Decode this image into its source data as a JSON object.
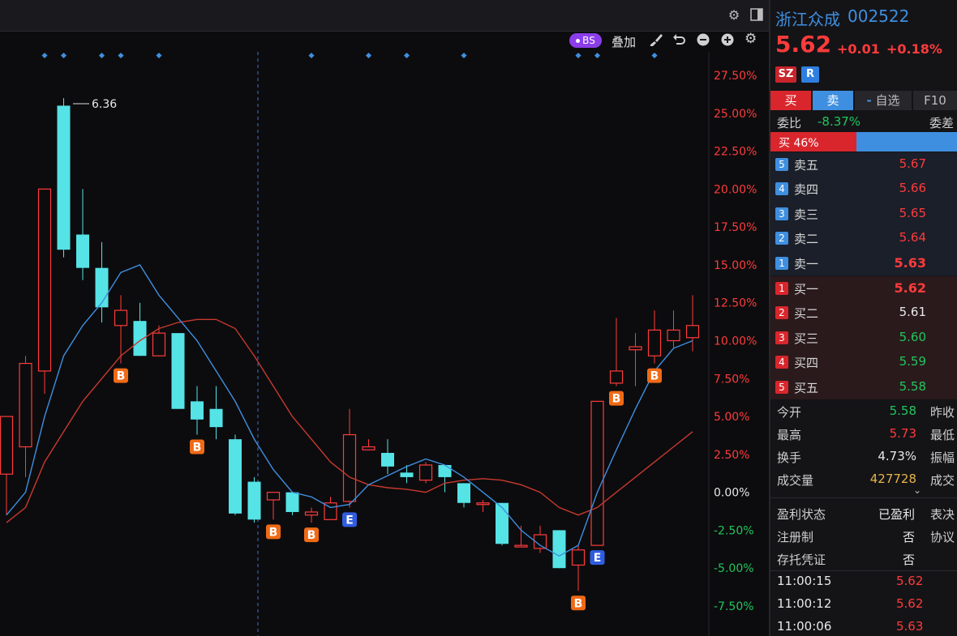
{
  "toolbar": {
    "bs_label": "BS",
    "overlay_label": "叠加"
  },
  "axis": {
    "right_labels": [
      "27.50%",
      "25.00%",
      "22.50%",
      "20.00%",
      "17.50%",
      "15.00%",
      "12.50%",
      "10.00%",
      "7.50%",
      "5.00%",
      "2.50%",
      "0.00%",
      "-2.50%",
      "-5.00%",
      "-7.50%"
    ],
    "top_marker_label": "6.36"
  },
  "colors": {
    "up": "#ff3b3b",
    "down": "#55e3e6",
    "ma_short": "#3f8fe0",
    "ma_long": "#c8392f",
    "b_marker": "#f06a16",
    "e_marker": "#2f5de0"
  },
  "chart_data": {
    "type": "candlestick",
    "y_axis": {
      "min_percent": -7.5,
      "max_percent": 27.5,
      "base_price": 5.62
    },
    "candles": [
      {
        "o": 1.2,
        "h": 5.0,
        "l": -1.5,
        "c": 5.0,
        "dir": "up"
      },
      {
        "o": 3.0,
        "h": 9.0,
        "l": 1.0,
        "c": 8.5,
        "dir": "up"
      },
      {
        "o": 8.0,
        "h": 20.0,
        "l": 6.5,
        "c": 20.0,
        "dir": "up"
      },
      {
        "o": 16.0,
        "h": 26.0,
        "l": 15.5,
        "c": 25.5,
        "dir": "down"
      },
      {
        "o": 17.0,
        "h": 20.0,
        "l": 14.0,
        "c": 14.8,
        "dir": "down"
      },
      {
        "o": 14.8,
        "h": 16.5,
        "l": 11.2,
        "c": 12.2,
        "dir": "down"
      },
      {
        "o": 11.0,
        "h": 13.0,
        "l": 8.5,
        "c": 12.0,
        "dir": "up"
      },
      {
        "o": 11.3,
        "h": 12.5,
        "l": 9.0,
        "c": 9.0,
        "dir": "down"
      },
      {
        "o": 9.0,
        "h": 11.0,
        "l": 9.0,
        "c": 10.5,
        "dir": "up"
      },
      {
        "o": 10.5,
        "h": 10.5,
        "l": 5.5,
        "c": 5.5,
        "dir": "down"
      },
      {
        "o": 6.0,
        "h": 7.0,
        "l": 3.8,
        "c": 4.8,
        "dir": "down"
      },
      {
        "o": 5.5,
        "h": 7.0,
        "l": 3.5,
        "c": 4.3,
        "dir": "down"
      },
      {
        "o": 3.5,
        "h": 3.8,
        "l": -1.5,
        "c": -1.4,
        "dir": "down"
      },
      {
        "o": 0.7,
        "h": 1.0,
        "l": -2.0,
        "c": -1.8,
        "dir": "down"
      },
      {
        "o": -0.5,
        "h": 0.0,
        "l": -1.8,
        "c": 0.0,
        "dir": "up"
      },
      {
        "o": 0.0,
        "h": 0.0,
        "l": -1.5,
        "c": -1.3,
        "dir": "down"
      },
      {
        "o": -1.5,
        "h": -1.0,
        "l": -2.0,
        "c": -1.3,
        "dir": "up"
      },
      {
        "o": -1.8,
        "h": -0.3,
        "l": -1.8,
        "c": -0.7,
        "dir": "up"
      },
      {
        "o": -0.6,
        "h": 5.5,
        "l": -1.0,
        "c": 3.8,
        "dir": "up"
      },
      {
        "o": 2.8,
        "h": 3.5,
        "l": 2.8,
        "c": 3.0,
        "dir": "up"
      },
      {
        "o": 2.6,
        "h": 3.5,
        "l": 1.2,
        "c": 1.7,
        "dir": "down"
      },
      {
        "o": 1.3,
        "h": 1.8,
        "l": 0.6,
        "c": 1.0,
        "dir": "down"
      },
      {
        "o": 0.8,
        "h": 2.0,
        "l": 0.6,
        "c": 1.8,
        "dir": "up"
      },
      {
        "o": 1.8,
        "h": 1.8,
        "l": 0.0,
        "c": 1.0,
        "dir": "down"
      },
      {
        "o": 0.6,
        "h": 0.6,
        "l": -1.0,
        "c": -0.7,
        "dir": "down"
      },
      {
        "o": -0.7,
        "h": -0.5,
        "l": -1.3,
        "c": -0.8,
        "dir": "up"
      },
      {
        "o": -0.7,
        "h": -0.7,
        "l": -3.5,
        "c": -3.4,
        "dir": "down"
      },
      {
        "o": -3.5,
        "h": -2.2,
        "l": -3.6,
        "c": -3.5,
        "dir": "up"
      },
      {
        "o": -3.7,
        "h": -2.2,
        "l": -4.0,
        "c": -2.8,
        "dir": "up"
      },
      {
        "o": -2.5,
        "h": -2.5,
        "l": -5.0,
        "c": -5.0,
        "dir": "down"
      },
      {
        "o": -4.8,
        "h": -3.5,
        "l": -6.5,
        "c": -3.8,
        "dir": "up"
      },
      {
        "o": -3.5,
        "h": 6.0,
        "l": -3.5,
        "c": 6.0,
        "dir": "up"
      },
      {
        "o": 7.2,
        "h": 11.5,
        "l": 7.0,
        "c": 8.0,
        "dir": "up"
      },
      {
        "o": 9.4,
        "h": 10.5,
        "l": 7.0,
        "c": 9.6,
        "dir": "up"
      },
      {
        "o": 9.0,
        "h": 12.0,
        "l": 8.5,
        "c": 10.7,
        "dir": "up"
      },
      {
        "o": 10.0,
        "h": 12.0,
        "l": 9.5,
        "c": 10.7,
        "dir": "up"
      },
      {
        "o": 10.2,
        "h": 13.0,
        "l": 9.3,
        "c": 11.0,
        "dir": "up"
      }
    ],
    "ma_short": [
      -1.5,
      0,
      5,
      9,
      11,
      12.5,
      14.5,
      15,
      13,
      11.5,
      10,
      8,
      6,
      3.5,
      1.5,
      0,
      -0.3,
      -1,
      -0.8,
      0.5,
      1.1,
      1.7,
      2.2,
      1.8,
      1,
      0,
      -1,
      -2.5,
      -3.5,
      -4.2,
      -3.5,
      0,
      2.8,
      5.5,
      8,
      9.5,
      10
    ],
    "ma_long": [
      -2,
      -1,
      2,
      4,
      6,
      7.5,
      9,
      10,
      10.8,
      11.2,
      11.4,
      11.4,
      10.8,
      9,
      7,
      5,
      3.5,
      2,
      1,
      0.5,
      0.3,
      0.2,
      0,
      0.6,
      0.8,
      0.9,
      0.8,
      0.5,
      0,
      -1,
      -1.5,
      -1,
      0,
      1,
      2,
      3,
      4
    ]
  },
  "markers": {
    "b_label": "B",
    "e_label": "E",
    "list": [
      {
        "type": "B",
        "candle": 6
      },
      {
        "type": "B",
        "candle": 10
      },
      {
        "type": "B",
        "candle": 14
      },
      {
        "type": "B",
        "candle": 16
      },
      {
        "type": "E",
        "candle": 18
      },
      {
        "type": "B",
        "candle": 30
      },
      {
        "type": "E",
        "candle": 31
      },
      {
        "type": "B",
        "candle": 32
      },
      {
        "type": "B",
        "candle": 34
      }
    ],
    "top_dots": [
      2,
      3,
      5,
      6,
      8,
      16,
      19,
      21,
      24,
      30,
      31,
      34
    ]
  },
  "panel": {
    "stock_name": "浙江众成",
    "stock_code": "002522",
    "price": "5.62",
    "change": "+0.01",
    "change_pct": "+0.18%",
    "tag_market": "SZ",
    "tag_r": "R",
    "tab_buy": "买",
    "tab_sell": "卖",
    "tab_watch": "自选",
    "tab_watch_prefix": "-",
    "tab_f10": "F10",
    "weibi_label": "委比",
    "weibi_value": "-8.37%",
    "weicha_label": "委差",
    "buy_ratio_label": "买 46%",
    "buy_ratio": 0.46,
    "asks": [
      {
        "num": "5",
        "name": "卖五",
        "price": "5.67"
      },
      {
        "num": "4",
        "name": "卖四",
        "price": "5.66"
      },
      {
        "num": "3",
        "name": "卖三",
        "price": "5.65"
      },
      {
        "num": "2",
        "name": "卖二",
        "price": "5.64"
      },
      {
        "num": "1",
        "name": "卖一",
        "price": "5.63"
      }
    ],
    "bids": [
      {
        "num": "1",
        "name": "买一",
        "price": "5.62"
      },
      {
        "num": "2",
        "name": "买二",
        "price": "5.61"
      },
      {
        "num": "3",
        "name": "买三",
        "price": "5.60"
      },
      {
        "num": "4",
        "name": "买四",
        "price": "5.59"
      },
      {
        "num": "5",
        "name": "买五",
        "price": "5.58"
      }
    ],
    "stats": [
      {
        "label": "今开",
        "value": "5.58",
        "color": "green",
        "label2": "昨收"
      },
      {
        "label": "最高",
        "value": "5.73",
        "color": "red",
        "label2": "最低"
      },
      {
        "label": "换手",
        "value": "4.73%",
        "color": "white",
        "label2": "振幅"
      },
      {
        "label": "成交量",
        "value": "427728",
        "color": "yellow",
        "label2": "成交"
      }
    ],
    "info": [
      {
        "label": "盈利状态",
        "value": "已盈利",
        "label2": "表决"
      },
      {
        "label": "注册制",
        "value": "否",
        "label2": "协议"
      },
      {
        "label": "存托凭证",
        "value": "否",
        "label2": ""
      }
    ],
    "ticks": [
      {
        "time": "11:00:15",
        "price": "5.62"
      },
      {
        "time": "11:00:12",
        "price": "5.62"
      },
      {
        "time": "11:00:06",
        "price": "5.63"
      }
    ]
  }
}
